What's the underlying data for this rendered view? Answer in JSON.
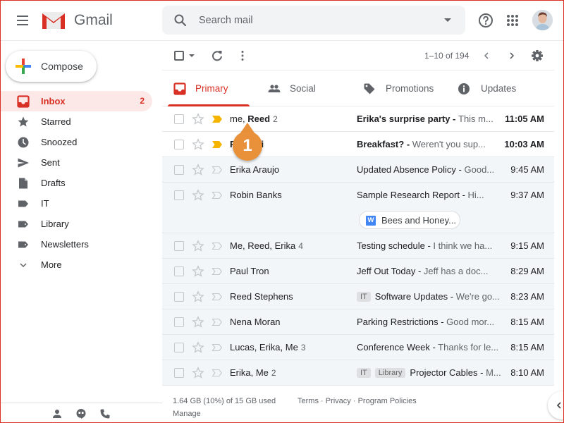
{
  "header": {
    "app_name": "Gmail",
    "search_placeholder": "Search mail"
  },
  "sidebar": {
    "compose_label": "Compose",
    "items": [
      {
        "label": "Inbox",
        "count": "2",
        "icon": "inbox-icon",
        "active": true
      },
      {
        "label": "Starred",
        "icon": "star-icon"
      },
      {
        "label": "Snoozed",
        "icon": "clock-icon"
      },
      {
        "label": "Sent",
        "icon": "send-icon"
      },
      {
        "label": "Drafts",
        "icon": "draft-icon"
      },
      {
        "label": "IT",
        "icon": "label-icon"
      },
      {
        "label": "Library",
        "icon": "label-icon"
      },
      {
        "label": "Newsletters",
        "icon": "label-icon"
      },
      {
        "label": "More",
        "icon": "chevron-down-icon"
      }
    ]
  },
  "toolbar": {
    "page_info": "1–10 of 194"
  },
  "tabs": [
    {
      "label": "Primary",
      "icon": "inbox-icon",
      "active": true
    },
    {
      "label": "Social",
      "icon": "people-icon"
    },
    {
      "label": "Promotions",
      "icon": "tag-icon"
    },
    {
      "label": "Updates",
      "icon": "info-icon"
    }
  ],
  "emails": [
    {
      "sender_plain": "me, ",
      "sender_bold": "Reed",
      "count": "2",
      "subject": "Erika's surprise party",
      "snippet": "This m...",
      "time": "11:05 AM",
      "unread": true,
      "important": true
    },
    {
      "sender_bold_a": "P",
      "sender_bold_b": "oni",
      "subject": "Breakfast?",
      "snippet": "Weren't you sup...",
      "time": "10:03 AM",
      "unread": true,
      "important": true
    },
    {
      "sender": "Erika Araujo",
      "subject": "Updated Absence Policy",
      "snippet": "Good...",
      "time": "9:45 AM"
    },
    {
      "sender": "Robin Banks",
      "subject": "Sample Research Report",
      "snippet": "Hi...",
      "time": "9:37 AM",
      "attachment": {
        "type": "W",
        "name": "Bees and Honey..."
      }
    },
    {
      "sender": "Me, Reed, Erika",
      "count": "4",
      "subject": "Testing schedule",
      "snippet": "I think we ha...",
      "time": "9:15 AM"
    },
    {
      "sender": "Paul Tron",
      "subject": "Jeff Out Today ",
      "snippet": "Jeff has a doc...",
      "time": "8:29 AM"
    },
    {
      "sender": "Reed Stephens",
      "labels": [
        "IT"
      ],
      "subject": "Software Updates",
      "snippet": "We're go...",
      "time": "8:23 AM"
    },
    {
      "sender": "Nena Moran",
      "subject": "Parking Restrictions",
      "snippet": "Good mor...",
      "time": "8:15 AM"
    },
    {
      "sender": "Lucas, Erika, Me",
      "count": "3",
      "subject": "Conference Week",
      "snippet": "Thanks for le...",
      "time": "8:15 AM"
    },
    {
      "sender": "Erika, Me",
      "count": "2",
      "labels": [
        "IT",
        "Library"
      ],
      "subject": "Projector Cables",
      "snippet": "M...",
      "time": "8:10 AM"
    }
  ],
  "footer": {
    "storage": "1.64 GB (10%) of 15 GB used",
    "manage": "Manage",
    "terms": "Terms",
    "privacy": "Privacy",
    "policies": "Program Policies",
    "separator": " · "
  },
  "callout": {
    "number": "1"
  },
  "colors": {
    "accent": "#d93025",
    "important": "#f4b400",
    "callout": "#e8913a"
  }
}
